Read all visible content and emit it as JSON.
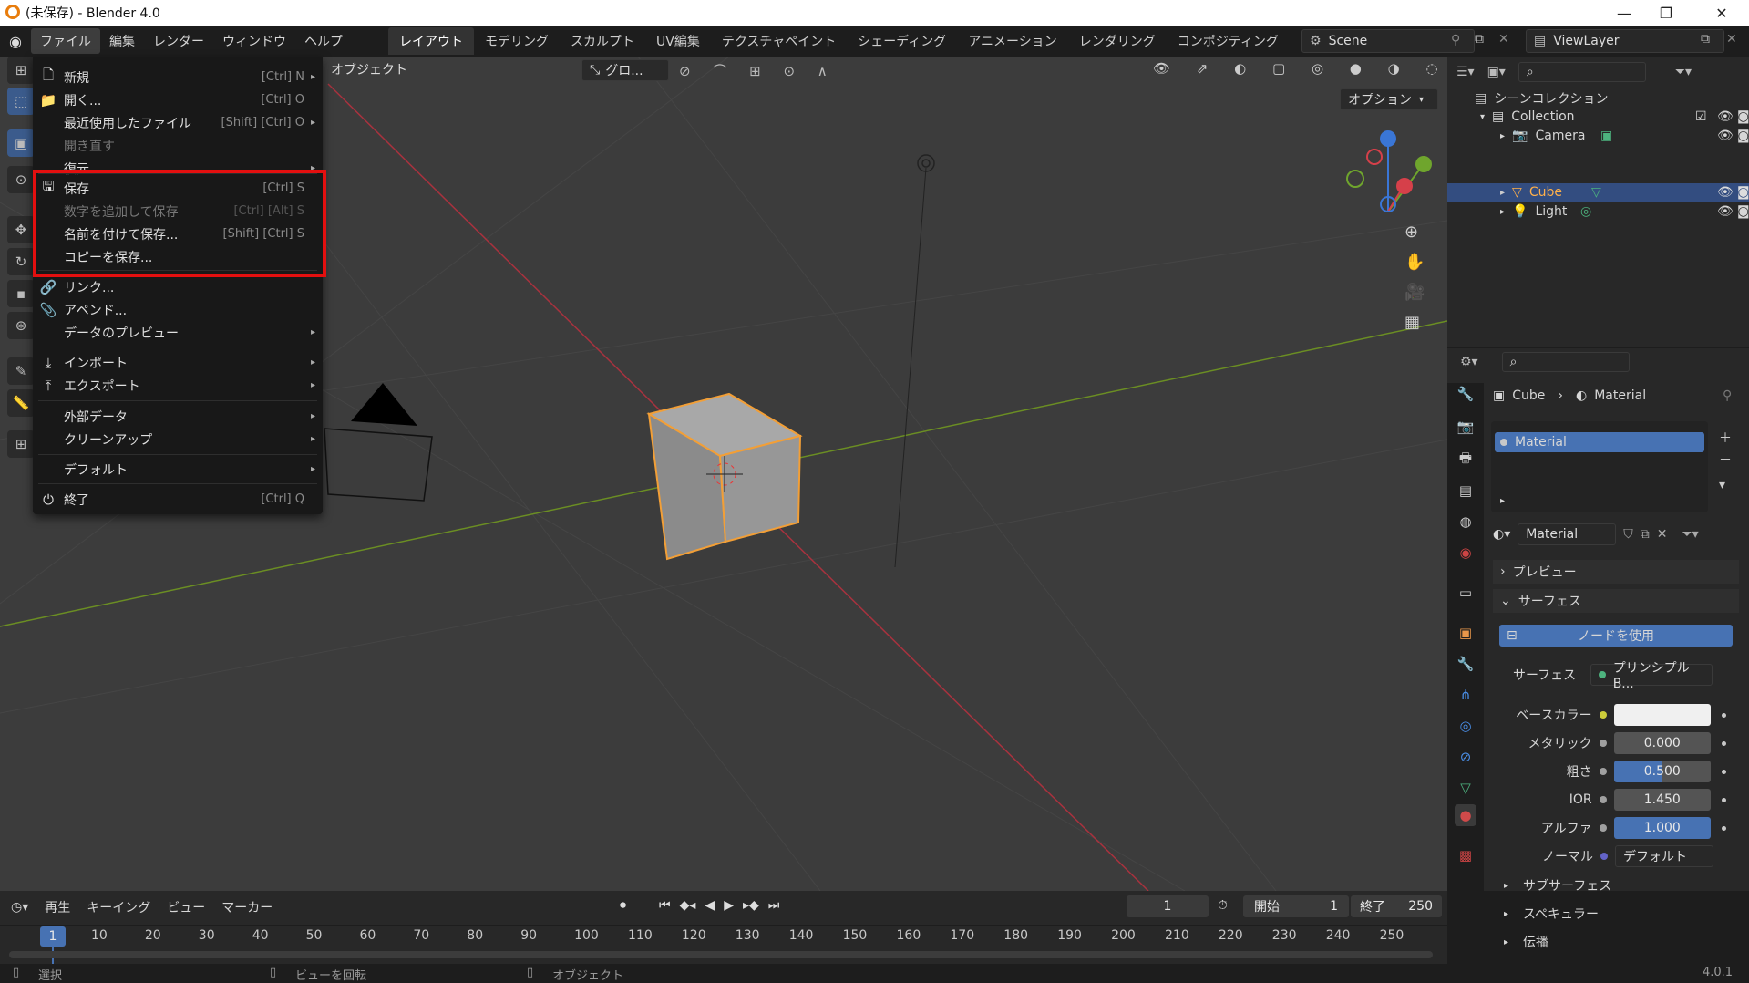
{
  "window": {
    "title": "(未保存) - Blender 4.0",
    "minimize": "—",
    "maximize": "❐",
    "close": "✕"
  },
  "topmenu": [
    "ファイル",
    "編集",
    "レンダー",
    "ウィンドウ",
    "ヘルプ"
  ],
  "workspaces": [
    "レイアウト",
    "モデリング",
    "スカルプト",
    "UV編集",
    "テクスチャペイント",
    "シェーディング",
    "アニメーション",
    "レンダリング",
    "コンポジティング"
  ],
  "scene": "Scene",
  "viewlayer": "ViewLayer",
  "viewport": {
    "object_menu": "オブジェクト",
    "transform": "グロ...",
    "options": "オプション"
  },
  "filemenu": {
    "new": {
      "label": "新規",
      "shortcut": "[Ctrl] N"
    },
    "open": {
      "label": "開く...",
      "shortcut": "[Ctrl] O"
    },
    "recent": {
      "label": "最近使用したファイル",
      "shortcut": "[Shift] [Ctrl] O"
    },
    "reopen": {
      "label": "開き直す"
    },
    "recover": {
      "label": "復元"
    },
    "save": {
      "label": "保存",
      "shortcut": "[Ctrl] S"
    },
    "save_inc": {
      "label": "数字を追加して保存",
      "shortcut": "[Ctrl] [Alt] S"
    },
    "save_as": {
      "label": "名前を付けて保存...",
      "shortcut": "[Shift] [Ctrl] S"
    },
    "save_copy": {
      "label": "コピーを保存..."
    },
    "link": {
      "label": "リンク..."
    },
    "append": {
      "label": "アペンド..."
    },
    "data_preview": {
      "label": "データのプレビュー"
    },
    "import": {
      "label": "インポート"
    },
    "export": {
      "label": "エクスポート"
    },
    "external": {
      "label": "外部データ"
    },
    "cleanup": {
      "label": "クリーンアップ"
    },
    "defaults": {
      "label": "デフォルト"
    },
    "quit": {
      "label": "終了",
      "shortcut": "[Ctrl] Q"
    }
  },
  "outliner": {
    "root": "シーンコレクション",
    "collection": "Collection",
    "items": [
      "Camera",
      "Cube",
      "Light"
    ]
  },
  "props": {
    "breadcrumb": [
      "Cube",
      "Material"
    ],
    "slot": "Material",
    "material_name": "Material",
    "preview": "プレビュー",
    "surface_panel": "サーフェス",
    "use_nodes": "ノードを使用",
    "surface_label": "サーフェス",
    "surface_value": "プリンシプルB...",
    "base_color": "ベースカラー",
    "metallic": {
      "label": "メタリック",
      "value": "0.000"
    },
    "roughness": {
      "label": "粗さ",
      "value": "0.500"
    },
    "ior": {
      "label": "IOR",
      "value": "1.450"
    },
    "alpha": {
      "label": "アルファ",
      "value": "1.000"
    },
    "normal": {
      "label": "ノーマル",
      "value": "デフォルト"
    },
    "subsurface": "サブサーフェス",
    "specular": "スペキュラー",
    "transmission": "伝播"
  },
  "timeline": {
    "play": "再生",
    "keying": "キーイング",
    "view": "ビュー",
    "marker": "マーカー",
    "frame": "1",
    "start_label": "開始",
    "start": "1",
    "end_label": "終了",
    "end": "250",
    "current": "1",
    "ticks": [
      "10",
      "20",
      "30",
      "40",
      "50",
      "60",
      "70",
      "80",
      "90",
      "100",
      "110",
      "120",
      "130",
      "140",
      "150",
      "160",
      "170",
      "180",
      "190",
      "200",
      "210",
      "220",
      "230",
      "240",
      "250"
    ]
  },
  "status": {
    "select": "選択",
    "rotate": "ビューを回転",
    "object": "オブジェクト",
    "version": "4.0.1"
  }
}
